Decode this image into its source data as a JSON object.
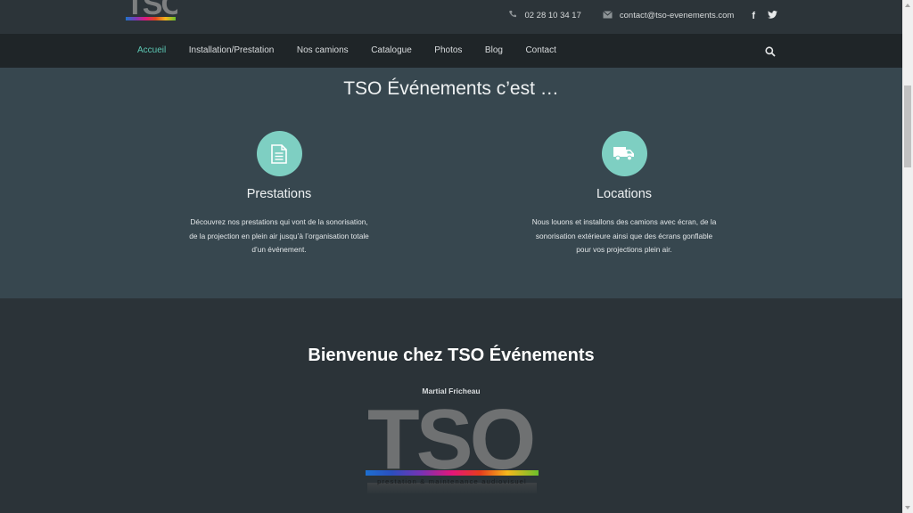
{
  "header": {
    "logo_text": "TSO",
    "phone": "02 28 10 34 17",
    "email": "contact@tso-evenements.com",
    "phone_icon": "phone-icon",
    "email_icon": "envelope-icon",
    "social": [
      {
        "name": "facebook-icon",
        "glyph": "f"
      },
      {
        "name": "twitter-icon",
        "glyph": "🐦"
      }
    ]
  },
  "nav": {
    "items": [
      "Accueil",
      "Installation/Prestation",
      "Nos camions",
      "Catalogue",
      "Photos",
      "Blog",
      "Contact"
    ],
    "active": "Accueil",
    "search_icon": "search-icon"
  },
  "intro": {
    "title": "TSO Événements c’est …",
    "features": [
      {
        "icon": "document-icon",
        "title": "Prestations",
        "text_lines": [
          "Découvrez nos prestations qui vont de la sonorisation,",
          "de la projection en plein air jusqu’à l’organisation totale",
          "d’un événement."
        ]
      },
      {
        "icon": "truck-icon",
        "title": "Locations",
        "text_lines": [
          "Nous louons et installons des camions avec écran, de la",
          "sonorisation extérieure ainsi que des écrans gonflable",
          "pour vos projections plein air."
        ]
      }
    ]
  },
  "welcome": {
    "bold1": "Bienvenue",
    "normal": " chez ",
    "bold2": "TSO Événements",
    "author": "Martial Fricheau"
  },
  "logo_big": {
    "text": "TSO",
    "tagline": "prestation & maintenance audiovisuel"
  },
  "colors": {
    "accent": "#5cc7b3",
    "circle": "#7ecfc2",
    "band": "#37474f",
    "page_bg": "#2b3338",
    "nav_bg": "#1f2528"
  }
}
